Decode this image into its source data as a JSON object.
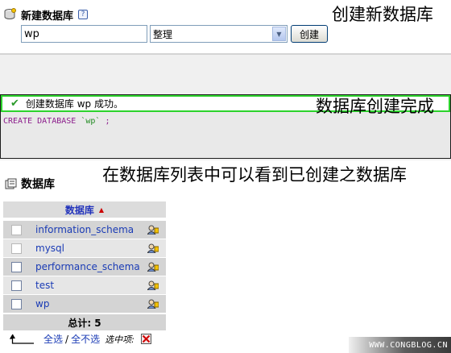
{
  "create_db": {
    "title": "新建数据库",
    "help_icon": "?",
    "name_value": "wp",
    "collation_value": "整理",
    "create_button": "创建"
  },
  "annotations": {
    "create_new": "创建新数据库",
    "create_done": "数据库创建完成",
    "in_list": "在数据库列表中可以看到已创建之数据库"
  },
  "result": {
    "message": "创建数据库 wp 成功。",
    "sql_keyword": "CREATE DATABASE ",
    "sql_name": "`wp`",
    "sql_end": " ;"
  },
  "databases": {
    "heading": "数据库",
    "column_header": "数据库",
    "rows": [
      {
        "name": "information_schema",
        "checkbox_enabled": false
      },
      {
        "name": "mysql",
        "checkbox_enabled": false
      },
      {
        "name": "performance_schema",
        "checkbox_enabled": true
      },
      {
        "name": "test",
        "checkbox_enabled": true
      },
      {
        "name": "wp",
        "checkbox_enabled": true
      }
    ],
    "total_label": "总计: 5"
  },
  "footer": {
    "check_all": "全选",
    "separator": "/",
    "uncheck_all": "全不选",
    "with_selected": "选中项:"
  },
  "watermark": "WWW.CONGBLOG.CN",
  "colors": {
    "link": "#1a3bb5",
    "success_border": "#2cd32c",
    "sql_keyword": "#8b1b8b",
    "sql_string": "#228b22",
    "sort_arrow": "#cc0000"
  },
  "icons": [
    "database-icon",
    "help-icon",
    "checkmark-icon",
    "sort-arrow-icon",
    "privileges-icon",
    "arrow-up-icon",
    "drop-icon"
  ]
}
